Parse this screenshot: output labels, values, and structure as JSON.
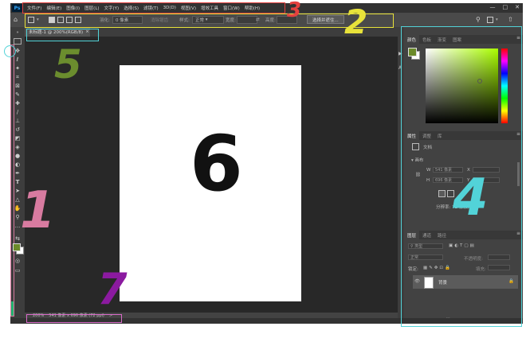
{
  "menubar": {
    "logo": "Ps",
    "items": [
      "文件(F)",
      "编辑(E)",
      "图像(I)",
      "图层(L)",
      "文字(Y)",
      "选择(S)",
      "滤镜(T)",
      "3D(D)",
      "视图(V)",
      "增效工具",
      "窗口(W)",
      "帮助(H)"
    ],
    "win": {
      "min": "—",
      "max": "□",
      "close": "✕"
    }
  },
  "options": {
    "feather_label": "羽化:",
    "feather_value": "0 像素",
    "antialias": "消除锯齿",
    "style_label": "样式:",
    "style_value": "正常",
    "width_label": "宽度:",
    "height_label": "高度:",
    "select_subject": "选择并遮住..."
  },
  "doc": {
    "tab_title": "未标题-1 @ 200%(RGB/8)",
    "tab_close": "×"
  },
  "status": {
    "zoom": "200%",
    "info": "541 像素 x 696 像素 (72 ppi)",
    "arrow": ">"
  },
  "panels": {
    "color_tabs": [
      "颜色",
      "色板",
      "渐变",
      "图案"
    ],
    "props_tabs": [
      "属性",
      "调整",
      "库"
    ],
    "doc_label": "文档",
    "canvas_label": "画布",
    "w_label": "W",
    "w_value": "541 像素",
    "h_label": "H",
    "h_value": "696 像素",
    "x_label": "X",
    "y_label": "Y",
    "resolution": "分辨率: 72 像素/英寸",
    "layers_tabs": [
      "图层",
      "通道",
      "路径"
    ],
    "layer_filter": "类型",
    "blend_mode": "正常",
    "opacity_label": "不透明度:",
    "lock_label": "锁定:",
    "fill_label": "填充:",
    "layer_name": "背景"
  },
  "colors": {
    "foreground": "#6b8a2a",
    "picker_hue": "#aaff00",
    "accent_green": "#21b26f"
  },
  "annotations": [
    {
      "label": "1",
      "color": "#d87ba0"
    },
    {
      "label": "2",
      "color": "#e8e23a"
    },
    {
      "label": "3",
      "color": "#e3413f"
    },
    {
      "label": "4",
      "color": "#52d3d8"
    },
    {
      "label": "5",
      "color": "#6b8d2e"
    },
    {
      "label": "6",
      "color": "#111111"
    },
    {
      "label": "7",
      "color": "#8b1aa0"
    }
  ]
}
